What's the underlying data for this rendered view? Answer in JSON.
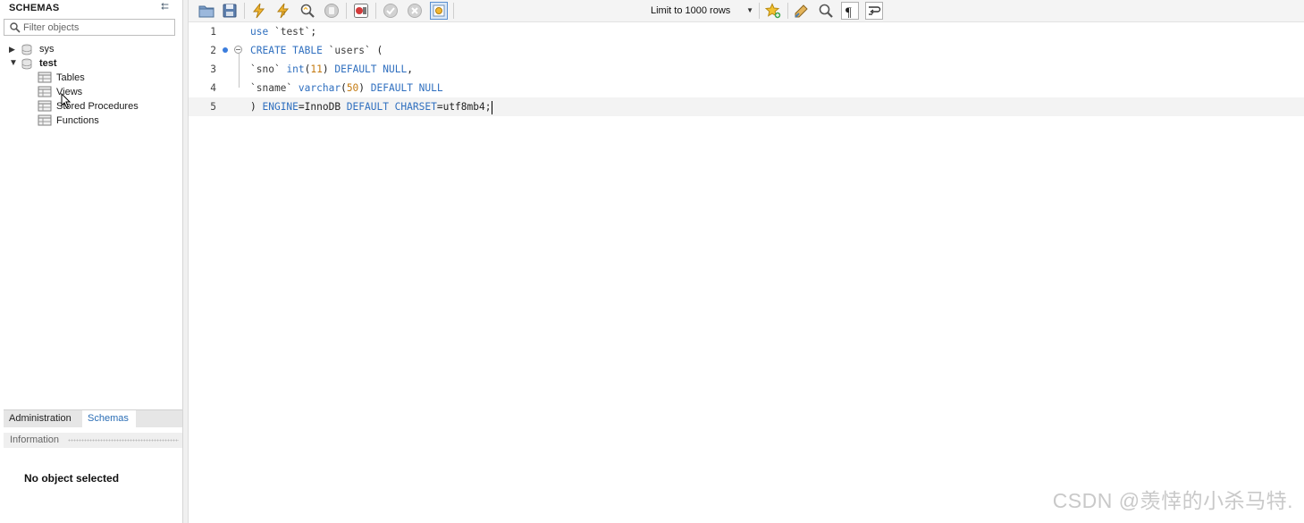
{
  "sidebar": {
    "header": "SCHEMAS",
    "filter_placeholder": "Filter objects",
    "schemas": [
      {
        "name": "sys",
        "expanded": false
      },
      {
        "name": "test",
        "expanded": true,
        "bold": true
      }
    ],
    "test_children": [
      "Tables",
      "Views",
      "Stored Procedures",
      "Functions"
    ],
    "tabs": {
      "administration": "Administration",
      "schemas": "Schemas"
    },
    "information_label": "Information",
    "no_object": "No object selected"
  },
  "toolbar": {
    "icons": [
      "open-folder-icon",
      "save-icon",
      "execute-icon",
      "execute-statement-icon",
      "explain-icon",
      "stop-icon",
      "toggle-stop-on-error-icon",
      "commit-icon",
      "rollback-icon",
      "autocommit-icon",
      "add-snippet-icon",
      "beautify-icon",
      "find-icon",
      "invisible-chars-icon",
      "wrap-lines-icon"
    ],
    "limit_label": "Limit to 1000 rows"
  },
  "editor": {
    "lines": [
      {
        "number": "1",
        "text": "use `test`;"
      },
      {
        "number": "2",
        "text": "CREATE TABLE `users` ("
      },
      {
        "number": "3",
        "text": "`sno` int(11) DEFAULT NULL,"
      },
      {
        "number": "4",
        "text": "`sname` varchar(50) DEFAULT NULL"
      },
      {
        "number": "5",
        "text": ") ENGINE=InnoDB DEFAULT CHARSET=utf8mb4;"
      }
    ],
    "current_line": 5
  },
  "watermark": "CSDN @羡悻的小杀马特.",
  "colors": {
    "keyword": "#2f6fbf",
    "number": "#c47a10",
    "accent": "#3b7ddd"
  }
}
